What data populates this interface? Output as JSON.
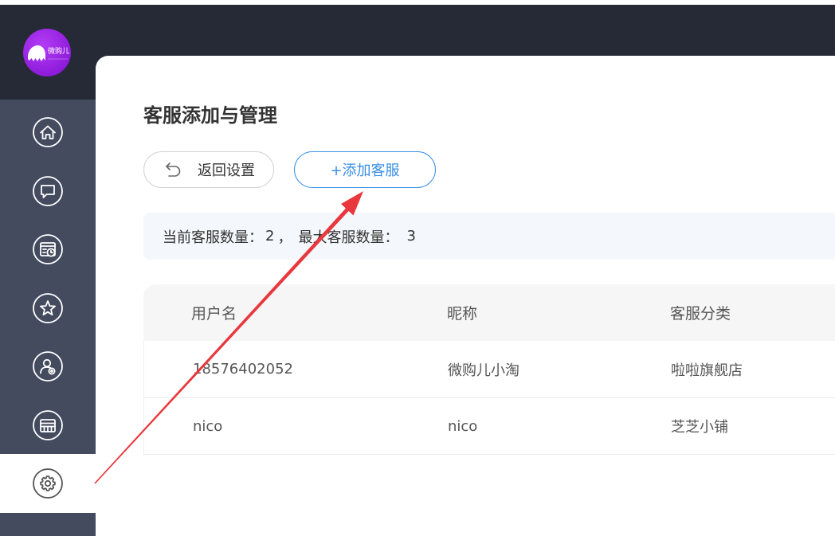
{
  "app": {
    "logo_text": "微购儿",
    "logo_color": "#9a23e6",
    "accent_color": "#3a8ee6",
    "annotation_color": "#e8383d"
  },
  "sidebar": {
    "items": [
      {
        "icon": "home-icon",
        "active": false
      },
      {
        "icon": "chat-icon",
        "active": false
      },
      {
        "icon": "schedule-icon",
        "active": false
      },
      {
        "icon": "star-icon",
        "active": false
      },
      {
        "icon": "user-settings-icon",
        "active": false
      },
      {
        "icon": "store-icon",
        "active": false
      },
      {
        "icon": "gear-icon",
        "active": true
      }
    ]
  },
  "page": {
    "title": "客服添加与管理",
    "back_button_label": "返回设置",
    "add_button_label": "+添加客服"
  },
  "stats": {
    "current_label": "当前客服数量：",
    "current_value": "2",
    "separator": "，",
    "max_label": "最大客服数量：",
    "max_value": "3"
  },
  "table": {
    "columns": [
      "用户名",
      "昵称",
      "客服分类"
    ],
    "rows": [
      [
        "18576402052",
        "微购儿小淘",
        "啦啦旗舰店"
      ],
      [
        "nico",
        "nico",
        "芝芝小铺"
      ]
    ]
  }
}
